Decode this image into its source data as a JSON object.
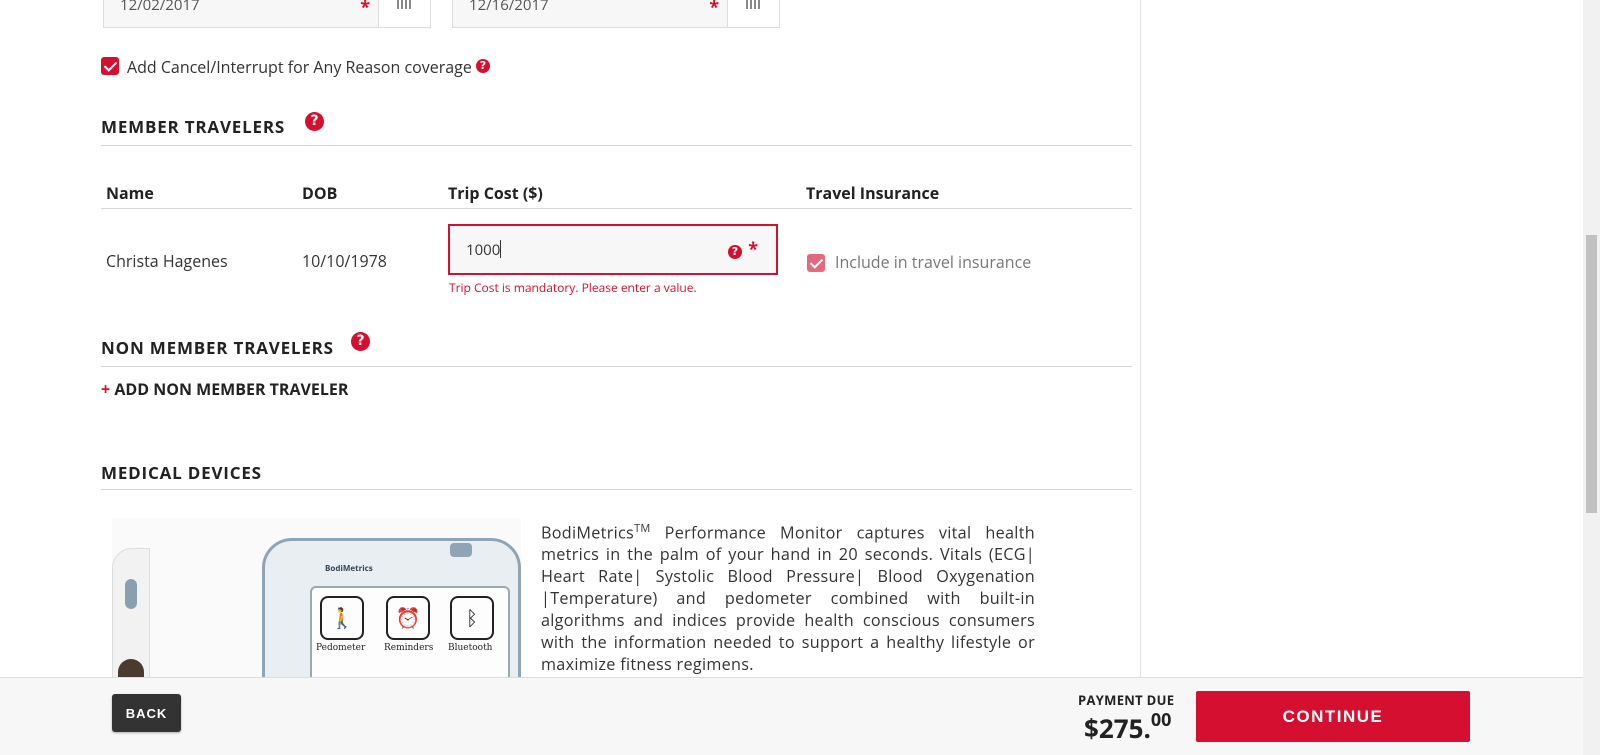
{
  "dates": {
    "start": "12/02/2017",
    "end": "12/16/2017",
    "required_mark": "*"
  },
  "cancel_coverage": {
    "label": "Add Cancel/Interrupt for Any Reason coverage",
    "checked": true
  },
  "help_glyph": "?",
  "member_travelers": {
    "title": "MEMBER TRAVELERS",
    "columns": {
      "name": "Name",
      "dob": "DOB",
      "trip_cost": "Trip Cost ($)",
      "travel_insurance": "Travel Insurance"
    },
    "rows": [
      {
        "name": "Christa Hagenes",
        "dob": "10/10/1978",
        "trip_cost": "1000",
        "include_label": "Include in travel insurance",
        "include_checked": true
      }
    ],
    "error": "Trip Cost is mandatory. Please enter a value."
  },
  "non_member_travelers": {
    "title": "NON MEMBER TRAVELERS",
    "add_plus": "+",
    "add_label": "ADD NON MEMBER TRAVELER"
  },
  "medical_devices": {
    "title": "MEDICAL DEVICES",
    "product_name": "BodiMetrics",
    "trademark": "TM",
    "description": " Performance Monitor captures vital health metrics in the palm of your hand in 20 seconds. Vitals (ECG| Heart Rate| Systolic Blood Pressure| Blood Oxygenation |Temperature) and pedometer combined with built-in algorithms and indices provide health conscious consumers with the information needed to support a healthy lifestyle or maximize fitness regimens.",
    "image_labels": {
      "brand": "BodiMetrics",
      "pedometer": "Pedometer",
      "reminders": "Reminders",
      "bluetooth": "Bluetooth"
    }
  },
  "footer": {
    "back_label": "BACK",
    "payment_due_label": "PAYMENT DUE",
    "amount_main": "$275.",
    "amount_cents": "00",
    "continue_label": "CONTINUE"
  },
  "colors": {
    "accent": "#d50f2f",
    "dark_button": "#333333"
  }
}
